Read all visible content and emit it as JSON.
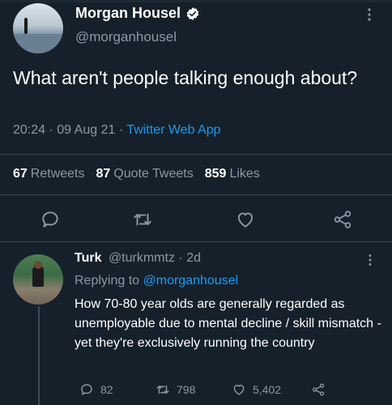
{
  "main_tweet": {
    "display_name": "Morgan Housel",
    "handle": "@morganhousel",
    "text": "What aren't people talking enough about?",
    "time": "20:24",
    "date": "09 Aug 21",
    "separator": "·",
    "source": "Twitter Web App",
    "stats": {
      "retweets_count": "67",
      "retweets_label": "Retweets",
      "quotes_count": "87",
      "quotes_label": "Quote Tweets",
      "likes_count": "859",
      "likes_label": "Likes"
    }
  },
  "reply": {
    "display_name": "Turk",
    "handle": "@turkmmtz",
    "separator": "·",
    "age": "2d",
    "replying_prefix": "Replying to",
    "replying_to": "@morganhousel",
    "text": "How 70-80 year olds are generally regarded as unemployable due to mental decline / skill mismatch - yet they're exclusively running the country",
    "reply_count": "82",
    "retweet_count": "798",
    "like_count": "5,402"
  },
  "icons": {
    "verified": "verified-badge-icon",
    "more": "more-vertical-icon",
    "reply": "reply-bubble-icon",
    "retweet": "retweet-icon",
    "like": "heart-icon",
    "share": "share-icon"
  },
  "colors": {
    "background": "#15202b",
    "accent": "#1d9bf0",
    "muted": "#8b98a5",
    "divider": "#38444d"
  }
}
